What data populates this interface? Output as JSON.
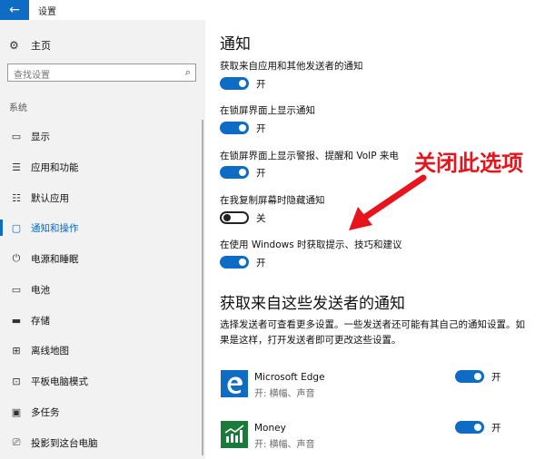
{
  "window": {
    "title": "设置"
  },
  "sidebar": {
    "home_label": "主页",
    "search_placeholder": "查找设置",
    "section_label": "系统",
    "items": [
      {
        "label": "显示",
        "icon": "monitor-icon"
      },
      {
        "label": "应用和功能",
        "icon": "list-icon"
      },
      {
        "label": "默认应用",
        "icon": "list-icon"
      },
      {
        "label": "通知和操作",
        "icon": "chat-icon",
        "active": true
      },
      {
        "label": "电源和睡眠",
        "icon": "power-icon"
      },
      {
        "label": "电池",
        "icon": "battery-icon"
      },
      {
        "label": "存储",
        "icon": "storage-icon"
      },
      {
        "label": "离线地图",
        "icon": "map-icon"
      },
      {
        "label": "平板电脑模式",
        "icon": "tablet-icon"
      },
      {
        "label": "多任务",
        "icon": "multitask-icon"
      },
      {
        "label": "投影到这台电脑",
        "icon": "project-icon"
      }
    ]
  },
  "main": {
    "heading": "通知",
    "settings": [
      {
        "label": "获取来自应用和其他发送者的通知",
        "state": "开",
        "on": true
      },
      {
        "label": "在锁屏界面上显示通知",
        "state": "开",
        "on": true
      },
      {
        "label": "在锁屏界面上显示警报、提醒和 VoIP 来电",
        "state": "开",
        "on": true
      },
      {
        "label": "在我复制屏幕时隐藏通知",
        "state": "关",
        "on": false
      },
      {
        "label": "在使用 Windows 时获取提示、技巧和建议",
        "state": "开",
        "on": true
      }
    ],
    "senders_heading": "获取来自这些发送者的通知",
    "senders_desc": "选择发送者可查看更多设置。一些发送者还可能有其自己的通知设置。如果是这样，打开发送者即可更改这些设置。",
    "senders": [
      {
        "name": "Microsoft Edge",
        "sub": "开: 横幅、声音",
        "state": "开",
        "on": true,
        "icon": "edge-icon",
        "color": "#0f6cc4"
      },
      {
        "name": "Money",
        "sub": "开: 横幅、声音",
        "state": "开",
        "on": true,
        "icon": "money-icon",
        "color": "#1a7a3a"
      }
    ]
  },
  "annotation": {
    "text": "关闭此选项",
    "color": "#e8141c"
  }
}
